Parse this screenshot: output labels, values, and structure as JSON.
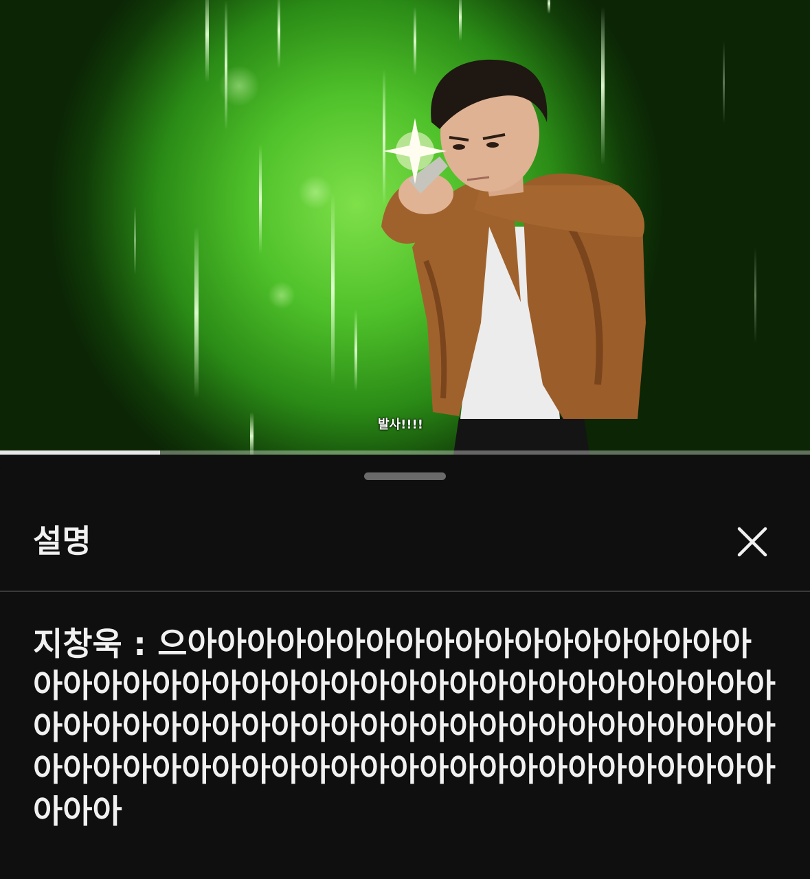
{
  "video": {
    "subtitle": "발사!!!!",
    "progress_fraction": 0.198
  },
  "description_sheet": {
    "title": "설명",
    "close_icon": "close-icon",
    "body_text": "지창욱 : 으아아아아아아아아아아아아아아아아아아아아아아아아아아아아아아아아아아아아아아아아아아아아아아아아아아아아아아아아아아아아아아아아아아아아아아아아아아아아아아아아아아아아아아아아아아아아아아아아아"
  },
  "colors": {
    "sheet_background": "#0f0f0f",
    "text": "#f1f1f1",
    "background_glow": "#4fc12a",
    "jacket": "#a0622c"
  }
}
